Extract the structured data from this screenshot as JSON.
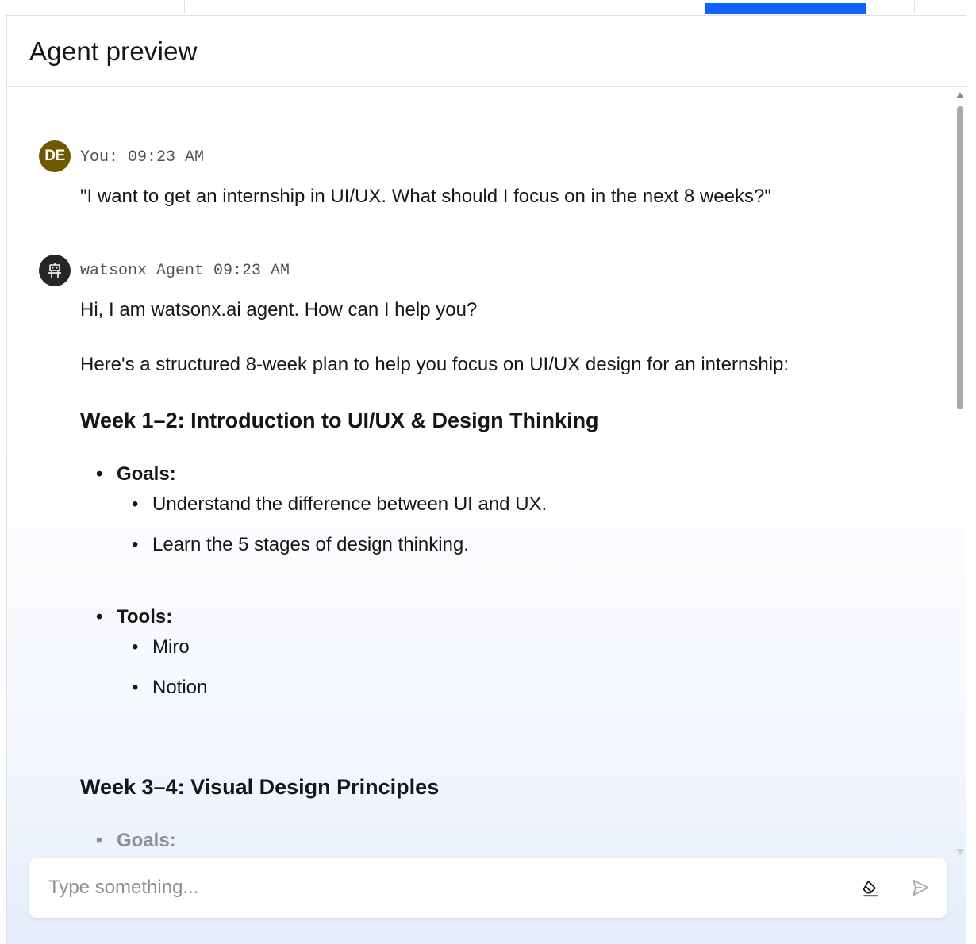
{
  "panel": {
    "title": "Agent preview"
  },
  "messages": {
    "user": {
      "initials": "DE",
      "meta": "You: 09:23 AM",
      "text": "\"I want to get an internship in UI/UX. What should I focus on in the next 8 weeks?\""
    },
    "agent": {
      "meta": "watsonx Agent 09:23 AM",
      "greeting": "Hi, I am watsonx.ai agent. How can I help you?",
      "intro": "Here's a structured 8-week plan to help you focus on UI/UX design for an internship:",
      "week1_heading": "Week 1–2: Introduction to UI/UX & Design Thinking",
      "week1_goals_label": "Goals:",
      "week1_goals": [
        "Understand the difference between UI and UX.",
        "Learn the 5 stages of design thinking."
      ],
      "week1_tools_label": "Tools:",
      "week1_tools": [
        "Miro",
        "Notion"
      ],
      "week3_heading": "Week 3–4: Visual Design Principles",
      "week3_goals_label": "Goals:"
    }
  },
  "input": {
    "placeholder": "Type something..."
  },
  "icons": {
    "eraser": "eraser-icon",
    "send": "send-icon",
    "agent_avatar": "robot-icon"
  },
  "colors": {
    "accent": "#0f62fe",
    "user_avatar": "#6f5a00",
    "agent_avatar": "#262626"
  }
}
